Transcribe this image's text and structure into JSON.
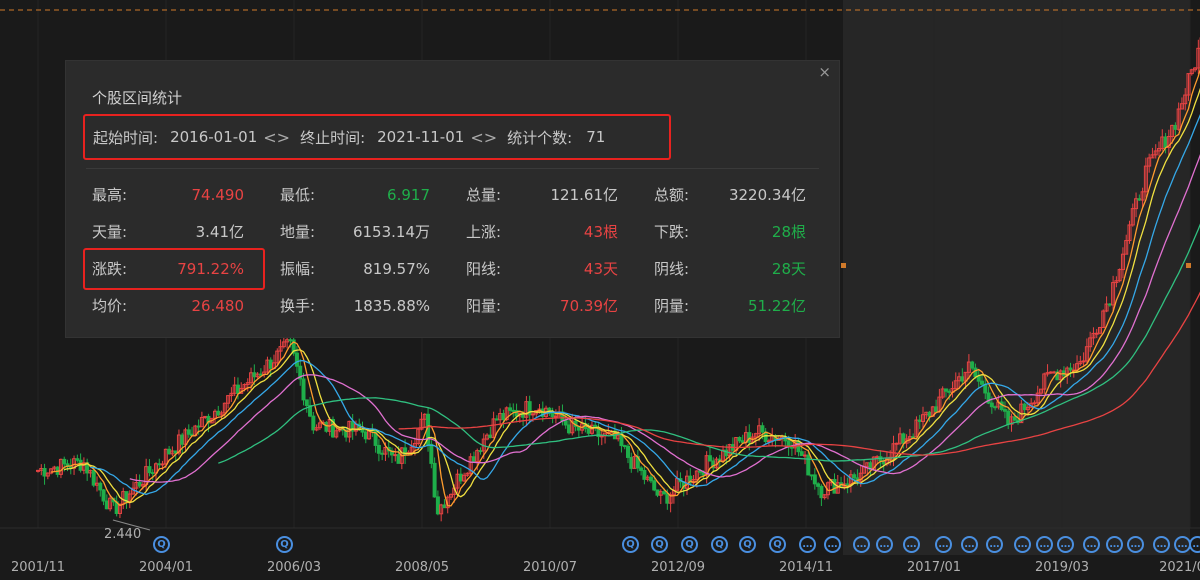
{
  "panel": {
    "title": "个股区间统计",
    "close": "×",
    "start_label": "起始时间:",
    "start_value": "2016-01-01",
    "end_label": "终止时间:",
    "end_value": "2021-11-01",
    "count_label": "统计个数:",
    "count_value": "71",
    "arrows": "<>",
    "stats": [
      [
        {
          "l": "最高:",
          "v": "74.490",
          "c": "red"
        },
        {
          "l": "最低:",
          "v": "6.917",
          "c": "green"
        },
        {
          "l": "总量:",
          "v": "121.61亿",
          "c": "gray"
        },
        {
          "l": "总额:",
          "v": "3220.34亿",
          "c": "gray"
        }
      ],
      [
        {
          "l": "天量:",
          "v": "3.41亿",
          "c": "gray"
        },
        {
          "l": "地量:",
          "v": "6153.14万",
          "c": "gray"
        },
        {
          "l": "上涨:",
          "v": "43根",
          "c": "red"
        },
        {
          "l": "下跌:",
          "v": "28根",
          "c": "green"
        }
      ],
      [
        {
          "l": "涨跌:",
          "v": "791.22%",
          "c": "red"
        },
        {
          "l": "振幅:",
          "v": "819.57%",
          "c": "gray"
        },
        {
          "l": "阳线:",
          "v": "43天",
          "c": "red"
        },
        {
          "l": "阴线:",
          "v": "28天",
          "c": "green"
        }
      ],
      [
        {
          "l": "均价:",
          "v": "26.480",
          "c": "red"
        },
        {
          "l": "换手:",
          "v": "1835.88%",
          "c": "gray"
        },
        {
          "l": "阳量:",
          "v": "70.39亿",
          "c": "red"
        },
        {
          "l": "阴量:",
          "v": "51.22亿",
          "c": "green"
        }
      ]
    ]
  },
  "chart": {
    "min_label": "2.440",
    "x_labels": [
      "2001/11",
      "2004/01",
      "2006/03",
      "2008/05",
      "2010/07",
      "2012/09",
      "2014/11",
      "2017/01",
      "2019/03",
      "2021/0"
    ],
    "keypoints": [
      [
        2001.8,
        3.4
      ],
      [
        2002.6,
        3.6
      ],
      [
        2003.1,
        2.6
      ],
      [
        2004.0,
        3.8
      ],
      [
        2005.0,
        5.4
      ],
      [
        2006.1,
        7.9
      ],
      [
        2006.5,
        4.6
      ],
      [
        2007.4,
        4.4
      ],
      [
        2007.9,
        3.6
      ],
      [
        2008.4,
        4.8
      ],
      [
        2008.6,
        2.6
      ],
      [
        2009.6,
        4.8
      ],
      [
        2010.3,
        5.3
      ],
      [
        2010.9,
        4.5
      ],
      [
        2011.6,
        4.2
      ],
      [
        2012.4,
        2.8
      ],
      [
        2013.2,
        3.6
      ],
      [
        2014.0,
        4.4
      ],
      [
        2014.6,
        4.2
      ],
      [
        2015.1,
        3.0
      ],
      [
        2015.8,
        3.3
      ],
      [
        2016.7,
        4.5
      ],
      [
        2017.6,
        6.8
      ],
      [
        2018.3,
        4.6
      ],
      [
        2019.0,
        6.5
      ],
      [
        2019.5,
        7.0
      ],
      [
        2020.0,
        11
      ],
      [
        2020.6,
        25
      ],
      [
        2021.1,
        35
      ],
      [
        2021.7,
        72
      ]
    ],
    "colors": {
      "up": "#e84343",
      "down": "#1fae4a",
      "ma": [
        "#ff9d2e",
        "#f0e040",
        "#35a8e8",
        "#e070d0",
        "#30c080",
        "#e84343"
      ]
    },
    "events": [
      "Q",
      "Q",
      "Q",
      "Q",
      "Q",
      "Q",
      "Q",
      "Q",
      "…",
      "…",
      "…",
      "…",
      "…",
      "…",
      "…",
      "…",
      "…",
      "…",
      "…",
      "…",
      "…",
      "…",
      "…",
      "…",
      "…"
    ]
  }
}
